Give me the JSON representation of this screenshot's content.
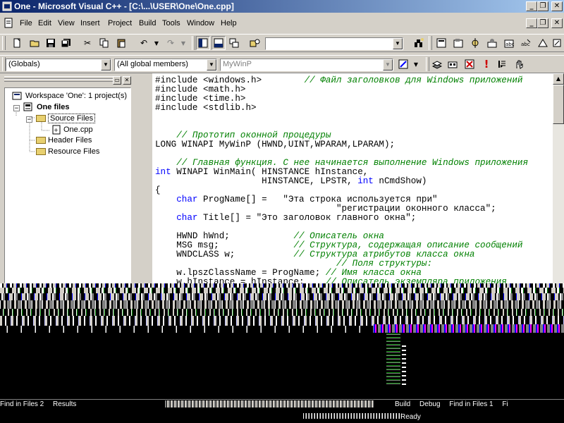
{
  "window": {
    "title": "One - Microsoft Visual C++ - [C:\\...\\USER\\One\\One.cpp]"
  },
  "menu": {
    "items": [
      "File",
      "Edit",
      "View",
      "Insert",
      "Project",
      "Build",
      "Tools",
      "Window",
      "Help"
    ]
  },
  "wizardbar": {
    "class_combo": "(Globals)",
    "filter_combo": "(All global members)",
    "members_combo": "MyWinP"
  },
  "workspace": {
    "root": "Workspace 'One': 1 project(s)",
    "project": "One files",
    "folders": {
      "source": "Source Files",
      "header": "Header Files",
      "resource": "Resource Files"
    },
    "file": "One.cpp"
  },
  "editor": {
    "lines": [
      [
        {
          "t": "#include <windows.h>        "
        },
        {
          "c": "cm",
          "t": "// Файл заголовков для Windows приложений"
        }
      ],
      [
        {
          "t": "#include <math.h>"
        }
      ],
      [
        {
          "t": "#include <time.h>"
        }
      ],
      [
        {
          "t": "#include <stdlib.h>"
        }
      ],
      [
        {
          "t": ""
        }
      ],
      [
        {
          "t": ""
        }
      ],
      [
        {
          "t": "    "
        },
        {
          "c": "cm",
          "t": "// Прототип оконной процедуры"
        }
      ],
      [
        {
          "t": "LONG WINAPI MyWinP (HWND,UINT,WPARAM,LPARAM);"
        }
      ],
      [
        {
          "t": ""
        }
      ],
      [
        {
          "t": "    "
        },
        {
          "c": "cm",
          "t": "// Главная функция. С нее начинается выполнение Windows приложения"
        }
      ],
      [
        {
          "c": "kw",
          "t": "int"
        },
        {
          "t": " WINAPI WinMain( HINSTANCE hInstance,"
        }
      ],
      [
        {
          "t": "                    HINSTANCE, LPSTR, "
        },
        {
          "c": "kw",
          "t": "int"
        },
        {
          "t": " nCmdShow)"
        }
      ],
      [
        {
          "t": "{"
        }
      ],
      [
        {
          "t": "    "
        },
        {
          "c": "kw",
          "t": "char"
        },
        {
          "t": " ProgName[] =   \"Эта строка используется при\""
        }
      ],
      [
        {
          "t": "                                  \"регистрации оконного класса\";"
        }
      ],
      [
        {
          "t": "    "
        },
        {
          "c": "kw",
          "t": "char"
        },
        {
          "t": " Title[] = \"Это заголовок главного окна\";"
        }
      ],
      [
        {
          "t": ""
        }
      ],
      [
        {
          "t": "    HWND hWnd;            "
        },
        {
          "c": "cm",
          "t": "// Описатель окна"
        }
      ],
      [
        {
          "t": "    MSG msg;              "
        },
        {
          "c": "cm",
          "t": "// Структура, содержащая описание сообщений"
        }
      ],
      [
        {
          "t": "    WNDCLASS w;           "
        },
        {
          "c": "cm",
          "t": "// Структура атрибутов класса окна"
        }
      ],
      [
        {
          "t": "                                  "
        },
        {
          "c": "cm",
          "t": "// Поля структуры:"
        }
      ],
      [
        {
          "t": "    w.lpszClassName = ProgName; "
        },
        {
          "c": "cm",
          "t": "// Имя класса окна"
        }
      ],
      [
        {
          "t": "    w.hInstance = hInstance;    "
        },
        {
          "c": "cm",
          "t": "// Описатель экземпляра приложения"
        }
      ]
    ]
  },
  "bottom_tabs": {
    "left": [
      "Find in Files 2",
      "Results"
    ],
    "right": [
      "Build",
      "Debug",
      "Find in Files 1",
      "Fi"
    ]
  },
  "status": {
    "text": "Ready"
  },
  "icons": [
    "app-icon",
    "minimize-icon",
    "restore-icon",
    "close-icon",
    "new-icon",
    "open-icon",
    "save-icon",
    "save-all-icon",
    "cut-icon",
    "copy-icon",
    "paste-icon",
    "undo-icon",
    "redo-icon",
    "workspace-icon",
    "output-icon",
    "window-list-icon",
    "find-in-files-icon",
    "find-icon",
    "compile-icon",
    "build-icon",
    "stop-build-icon",
    "execute-icon",
    "go-icon",
    "breakpoint-icon",
    "class-wizard-icon",
    "wizard-action-icon"
  ]
}
